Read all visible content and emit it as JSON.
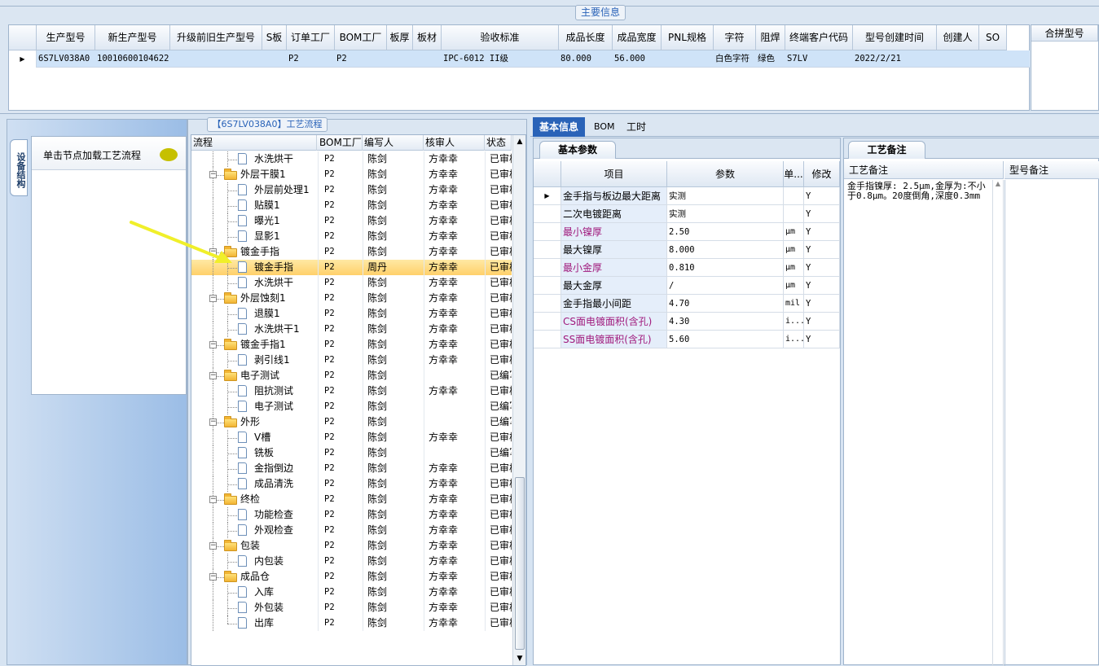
{
  "main_info": {
    "title": "主要信息",
    "columns": [
      "生产型号",
      "新生产型号",
      "升级前旧生产型号",
      "S板",
      "订单工厂",
      "BOM工厂",
      "板厚",
      "板材",
      "验收标准",
      "成品长度",
      "成品宽度",
      "PNL规格",
      "字符",
      "阻焊",
      "终端客户代码",
      "型号创建时间",
      "创建人",
      "SO"
    ],
    "row": [
      "6S7LV038A0",
      "10010600104622",
      "",
      "",
      "P2",
      "P2",
      "",
      "",
      "IPC-6012 II级",
      "80.000",
      "56.000",
      "",
      "白色字符",
      "绿色",
      "S7LV",
      "2022/2/21",
      "",
      ""
    ],
    "merge_label": "合拼型号"
  },
  "left_panel": {
    "vertical_tab": "设备结构",
    "hint": "单击节点加载工艺流程"
  },
  "process": {
    "title": "【6S7LV038A0】工艺流程",
    "columns": [
      "流程",
      "BOM工厂",
      "编写人",
      "核审人",
      "状态"
    ],
    "rows": [
      {
        "name": "水洗烘干",
        "factory": "P2",
        "writer": "陈剑",
        "reviewer": "方幸幸",
        "status": "已审核"
      },
      {
        "name": "外层干膜1",
        "factory": "P2",
        "writer": "陈剑",
        "reviewer": "方幸幸",
        "status": "已审核"
      },
      {
        "name": "外层前处理1",
        "factory": "P2",
        "writer": "陈剑",
        "reviewer": "方幸幸",
        "status": "已审核"
      },
      {
        "name": "贴膜1",
        "factory": "P2",
        "writer": "陈剑",
        "reviewer": "方幸幸",
        "status": "已审核"
      },
      {
        "name": "曝光1",
        "factory": "P2",
        "writer": "陈剑",
        "reviewer": "方幸幸",
        "status": "已审核"
      },
      {
        "name": "显影1",
        "factory": "P2",
        "writer": "陈剑",
        "reviewer": "方幸幸",
        "status": "已审核"
      },
      {
        "name": "镀金手指",
        "factory": "P2",
        "writer": "陈剑",
        "reviewer": "方幸幸",
        "status": "已审核"
      },
      {
        "name": "镀金手指",
        "factory": "P2",
        "writer": "周丹",
        "reviewer": "方幸幸",
        "status": "已审核"
      },
      {
        "name": "水洗烘干",
        "factory": "P2",
        "writer": "陈剑",
        "reviewer": "方幸幸",
        "status": "已审核"
      },
      {
        "name": "外层蚀刻1",
        "factory": "P2",
        "writer": "陈剑",
        "reviewer": "方幸幸",
        "status": "已审核"
      },
      {
        "name": "退膜1",
        "factory": "P2",
        "writer": "陈剑",
        "reviewer": "方幸幸",
        "status": "已审核"
      },
      {
        "name": "水洗烘干1",
        "factory": "P2",
        "writer": "陈剑",
        "reviewer": "方幸幸",
        "status": "已审核"
      },
      {
        "name": "镀金手指1",
        "factory": "P2",
        "writer": "陈剑",
        "reviewer": "方幸幸",
        "status": "已审核"
      },
      {
        "name": "剥引线1",
        "factory": "P2",
        "writer": "陈剑",
        "reviewer": "方幸幸",
        "status": "已审核"
      },
      {
        "name": "电子测试",
        "factory": "P2",
        "writer": "陈剑",
        "reviewer": "",
        "status": "已编写"
      },
      {
        "name": "阻抗测试",
        "factory": "P2",
        "writer": "陈剑",
        "reviewer": "方幸幸",
        "status": "已审核"
      },
      {
        "name": "电子测试",
        "factory": "P2",
        "writer": "陈剑",
        "reviewer": "",
        "status": "已编写"
      },
      {
        "name": "外形",
        "factory": "P2",
        "writer": "陈剑",
        "reviewer": "",
        "status": "已编写"
      },
      {
        "name": "V槽",
        "factory": "P2",
        "writer": "陈剑",
        "reviewer": "方幸幸",
        "status": "已审核"
      },
      {
        "name": "铣板",
        "factory": "P2",
        "writer": "陈剑",
        "reviewer": "",
        "status": "已编写"
      },
      {
        "name": "金指倒边",
        "factory": "P2",
        "writer": "陈剑",
        "reviewer": "方幸幸",
        "status": "已审核"
      },
      {
        "name": "成品清洗",
        "factory": "P2",
        "writer": "陈剑",
        "reviewer": "方幸幸",
        "status": "已审核"
      },
      {
        "name": "终检",
        "factory": "P2",
        "writer": "陈剑",
        "reviewer": "方幸幸",
        "status": "已审核"
      },
      {
        "name": "功能检查",
        "factory": "P2",
        "writer": "陈剑",
        "reviewer": "方幸幸",
        "status": "已审核"
      },
      {
        "name": "外观检查",
        "factory": "P2",
        "writer": "陈剑",
        "reviewer": "方幸幸",
        "status": "已审核"
      },
      {
        "name": "包装",
        "factory": "P2",
        "writer": "陈剑",
        "reviewer": "方幸幸",
        "status": "已审核"
      },
      {
        "name": "内包装",
        "factory": "P2",
        "writer": "陈剑",
        "reviewer": "方幸幸",
        "status": "已审核"
      },
      {
        "name": "成品仓",
        "factory": "P2",
        "writer": "陈剑",
        "reviewer": "方幸幸",
        "status": "已审核"
      },
      {
        "name": "入库",
        "factory": "P2",
        "writer": "陈剑",
        "reviewer": "方幸幸",
        "status": "已审核"
      },
      {
        "name": "外包装",
        "factory": "P2",
        "writer": "陈剑",
        "reviewer": "方幸幸",
        "status": "已审核"
      },
      {
        "name": "出库",
        "factory": "P2",
        "writer": "陈剑",
        "reviewer": "方幸幸",
        "status": "已审核"
      }
    ]
  },
  "tabs": [
    "基本信息",
    "BOM",
    "工时"
  ],
  "params": {
    "tab": "基本参数",
    "columns": [
      "项目",
      "参数",
      "单...",
      "修改"
    ],
    "rows": [
      {
        "item": "金手指与板边最大距离",
        "value": "实测",
        "unit": "",
        "mod": "Y",
        "highlight": false
      },
      {
        "item": "二次电镀距离",
        "value": "实测",
        "unit": "",
        "mod": "Y",
        "highlight": false
      },
      {
        "item": "最小镍厚",
        "value": "2.50",
        "unit": "μm",
        "mod": "Y",
        "highlight": true
      },
      {
        "item": "最大镍厚",
        "value": "8.000",
        "unit": "μm",
        "mod": "Y",
        "highlight": false
      },
      {
        "item": "最小金厚",
        "value": "0.810",
        "unit": "μm",
        "mod": "Y",
        "highlight": true
      },
      {
        "item": "最大金厚",
        "value": "/",
        "unit": "μm",
        "mod": "Y",
        "highlight": false
      },
      {
        "item": "金手指最小间距",
        "value": "4.70",
        "unit": "mil",
        "mod": "Y",
        "highlight": false
      },
      {
        "item": "CS面电镀面积(含孔)",
        "value": "4.30",
        "unit": "i...",
        "mod": "Y",
        "highlight": true
      },
      {
        "item": "SS面电镀面积(含孔)",
        "value": "5.60",
        "unit": "i...",
        "mod": "Y",
        "highlight": true
      }
    ]
  },
  "remarks": {
    "tab": "工艺备注",
    "col1": "工艺备注",
    "col2": "型号备注",
    "text": "金手指镍厚: 2.5μm,金厚为:不小于0.8μm。20度倒角,深度0.3mm"
  },
  "colors": {
    "accent": "#2a63b8",
    "highlight_text": "#a0197c",
    "selected_row": "#ffd978"
  }
}
